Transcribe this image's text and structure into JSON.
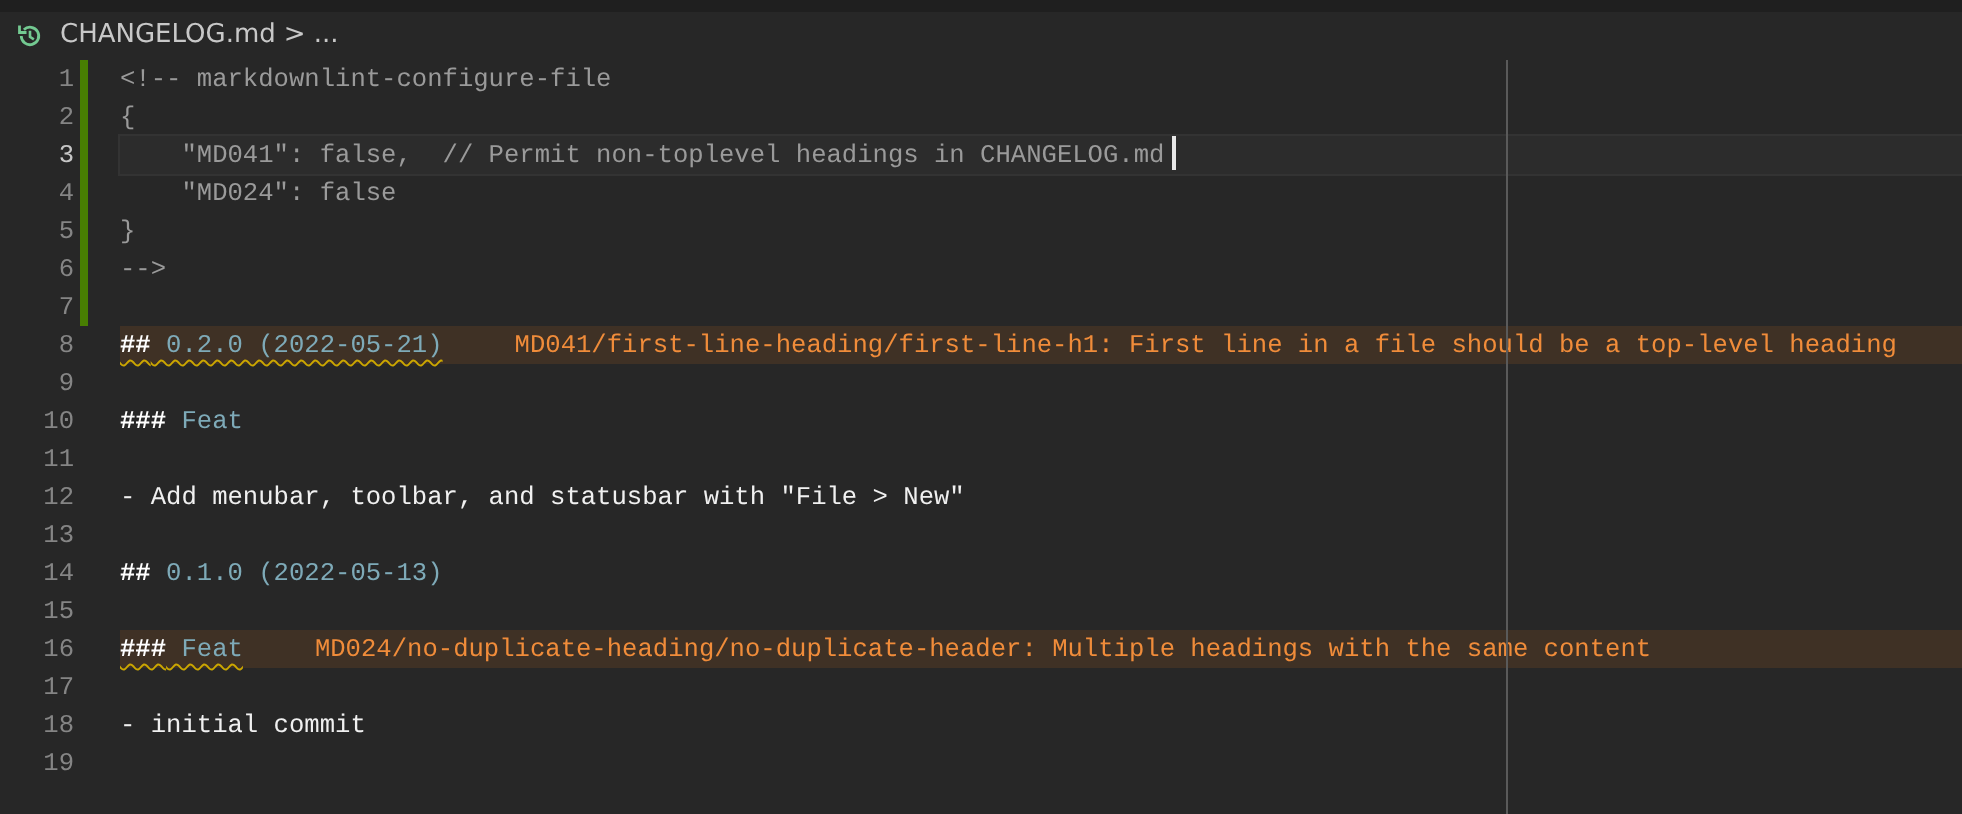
{
  "breadcrumb": {
    "file": "CHANGELOG.md",
    "separator": ">",
    "more": "..."
  },
  "lines": [
    {
      "number": "1",
      "modified": true,
      "current": false,
      "tokens": [
        {
          "kind": "comment",
          "text": "<!-- markdownlint-configure-file"
        }
      ]
    },
    {
      "number": "2",
      "modified": true,
      "current": false,
      "tokens": [
        {
          "kind": "comment",
          "text": "{"
        }
      ]
    },
    {
      "number": "3",
      "modified": true,
      "current": true,
      "tokens": [
        {
          "kind": "comment",
          "text": "    \"MD041\": false,  // Permit non-toplevel headings in CHANGELOG.md"
        }
      ]
    },
    {
      "number": "4",
      "modified": true,
      "current": false,
      "tokens": [
        {
          "kind": "comment",
          "text": "    \"MD024\": false"
        }
      ]
    },
    {
      "number": "5",
      "modified": true,
      "current": false,
      "tokens": [
        {
          "kind": "comment",
          "text": "}"
        }
      ]
    },
    {
      "number": "6",
      "modified": true,
      "current": false,
      "tokens": [
        {
          "kind": "comment",
          "text": "-->"
        }
      ]
    },
    {
      "number": "7",
      "modified": true,
      "current": false
    },
    {
      "number": "8",
      "modified": false,
      "current": false,
      "tokens": [
        {
          "kind": "heading-mark",
          "text": "##"
        },
        {
          "kind": "heading-text",
          "text": " 0.2.0 (2022-05-21)"
        }
      ],
      "diagnostic": "MD041/first-line-heading/first-line-h1: First line in a file should be a top-level heading"
    },
    {
      "number": "9",
      "modified": false,
      "current": false
    },
    {
      "number": "10",
      "modified": false,
      "current": false,
      "tokens": [
        {
          "kind": "heading-mark",
          "text": "###"
        },
        {
          "kind": "heading-text",
          "text": " Feat"
        }
      ]
    },
    {
      "number": "11",
      "modified": false,
      "current": false
    },
    {
      "number": "12",
      "modified": false,
      "current": false,
      "tokens": [
        {
          "kind": "text",
          "text": "- Add menubar, toolbar, and statusbar with \"File > New\""
        }
      ]
    },
    {
      "number": "13",
      "modified": false,
      "current": false
    },
    {
      "number": "14",
      "modified": false,
      "current": false,
      "tokens": [
        {
          "kind": "heading-mark",
          "text": "##"
        },
        {
          "kind": "heading-text",
          "text": " 0.1.0 (2022-05-13)"
        }
      ]
    },
    {
      "number": "15",
      "modified": false,
      "current": false
    },
    {
      "number": "16",
      "modified": false,
      "current": false,
      "tokens": [
        {
          "kind": "heading-mark",
          "text": "###"
        },
        {
          "kind": "heading-text",
          "text": " Feat"
        }
      ],
      "diagnostic": "MD024/no-duplicate-heading/no-duplicate-header: Multiple headings with the same content"
    },
    {
      "number": "17",
      "modified": false,
      "current": false
    },
    {
      "number": "18",
      "modified": false,
      "current": false,
      "tokens": [
        {
          "kind": "text",
          "text": "- initial commit"
        }
      ]
    },
    {
      "number": "19",
      "modified": false,
      "current": false
    }
  ]
}
